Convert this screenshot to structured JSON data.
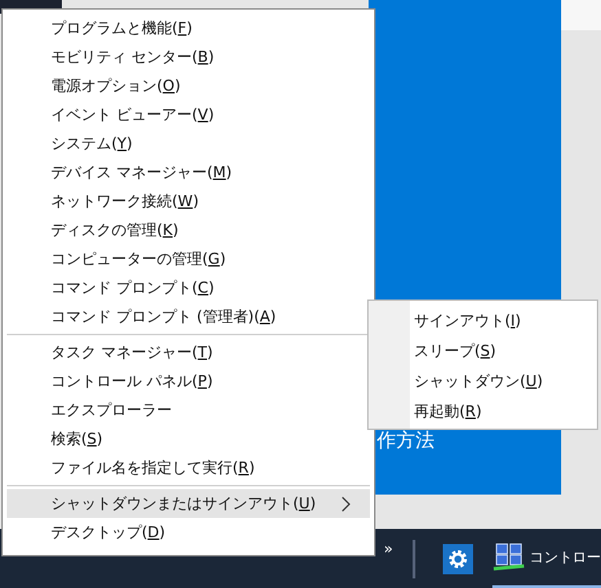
{
  "background": {
    "text": "作方法"
  },
  "menu": {
    "groups": [
      [
        {
          "label": "プログラムと機能(F)",
          "selected": false,
          "has_submenu": false
        },
        {
          "label": "モビリティ センター(B)",
          "selected": false,
          "has_submenu": false
        },
        {
          "label": "電源オプション(O)",
          "selected": false,
          "has_submenu": false
        },
        {
          "label": "イベント ビューアー(V)",
          "selected": false,
          "has_submenu": false
        },
        {
          "label": "システム(Y)",
          "selected": false,
          "has_submenu": false
        },
        {
          "label": "デバイス マネージャー(M)",
          "selected": false,
          "has_submenu": false
        },
        {
          "label": "ネットワーク接続(W)",
          "selected": false,
          "has_submenu": false
        },
        {
          "label": "ディスクの管理(K)",
          "selected": false,
          "has_submenu": false
        },
        {
          "label": "コンピューターの管理(G)",
          "selected": false,
          "has_submenu": false
        },
        {
          "label": "コマンド プロンプト(C)",
          "selected": false,
          "has_submenu": false
        },
        {
          "label": "コマンド プロンプト (管理者)(A)",
          "selected": false,
          "has_submenu": false
        }
      ],
      [
        {
          "label": "タスク マネージャー(T)",
          "selected": false,
          "has_submenu": false
        },
        {
          "label": "コントロール パネル(P)",
          "selected": false,
          "has_submenu": false
        },
        {
          "label": "エクスプローラー",
          "selected": false,
          "has_submenu": false
        },
        {
          "label": "検索(S)",
          "selected": false,
          "has_submenu": false
        },
        {
          "label": "ファイル名を指定して実行(R)",
          "selected": false,
          "has_submenu": false
        }
      ],
      [
        {
          "label": "シャットダウンまたはサインアウト(U)",
          "selected": true,
          "has_submenu": true
        },
        {
          "label": "デスクトップ(D)",
          "selected": false,
          "has_submenu": false
        }
      ]
    ]
  },
  "submenu": {
    "items": [
      {
        "label": "サインアウト(I)"
      },
      {
        "label": "スリープ(S)"
      },
      {
        "label": "シャットダウン(U)"
      },
      {
        "label": "再起動(R)"
      }
    ]
  },
  "taskbar": {
    "overflow": "»",
    "app_label": "コントロー"
  }
}
